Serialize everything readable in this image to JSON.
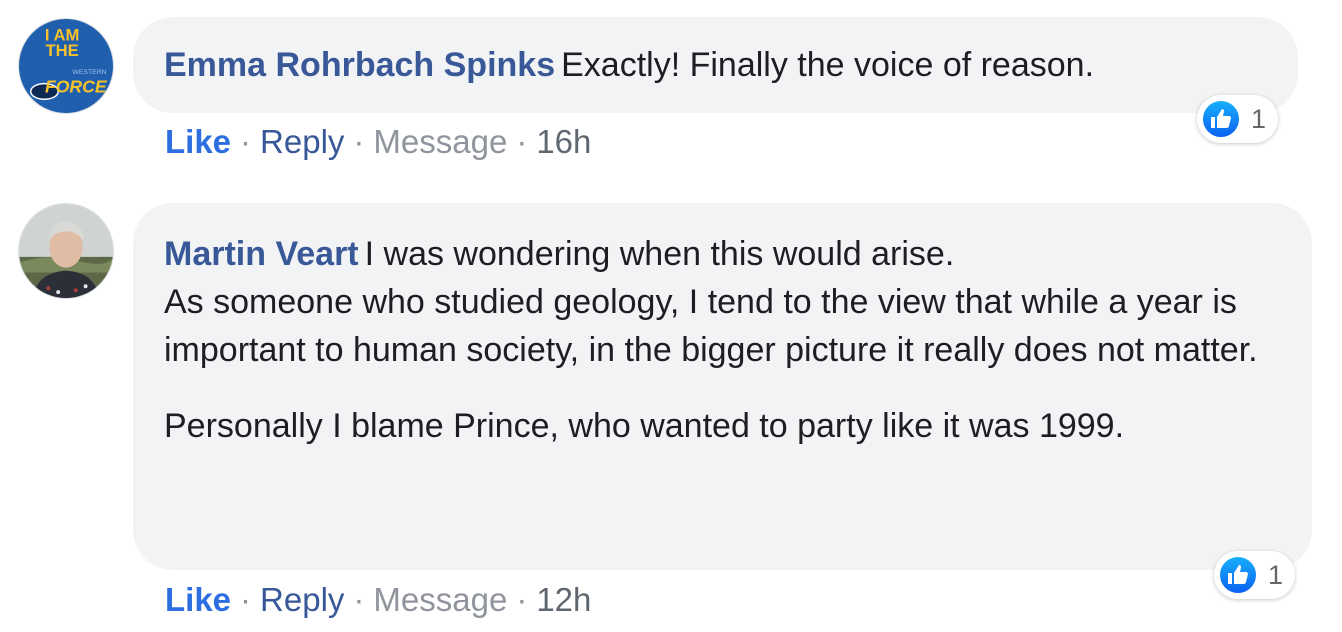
{
  "comments": [
    {
      "author": "Emma Rohrbach Spinks",
      "paragraphs": [
        "Exactly! Finally the voice of reason."
      ],
      "avatar_text": [
        "I AM",
        "THE",
        "WESTERN",
        "FORCE"
      ],
      "reaction_count": "1",
      "actions": {
        "like": "Like",
        "reply": "Reply",
        "message": "Message",
        "time": "16h"
      }
    },
    {
      "author": "Martin Veart",
      "paragraphs": [
        "I was wondering when this would arise.\nAs someone who studied geology, I tend to the view that while a year is important to human society, in the bigger picture it really does not matter.",
        "Personally I blame Prince, who wanted to party like it was 1999."
      ],
      "reaction_count": "1",
      "actions": {
        "like": "Like",
        "reply": "Reply",
        "message": "Message",
        "time": "12h"
      }
    }
  ],
  "separator": "·",
  "colors": {
    "author": "#385898",
    "like": "#2d6fe0",
    "bubble": "#f2f3f5",
    "reaction_gradient_top": "#18aefc",
    "reaction_gradient_bottom": "#0a62f1"
  },
  "icons": {
    "reaction": "thumbs-up-icon"
  }
}
